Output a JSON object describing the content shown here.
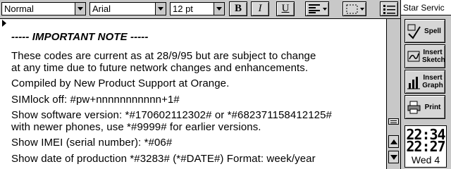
{
  "toolbar": {
    "style_select": "Normal",
    "font_select": "Arial",
    "size_select": "12 pt",
    "bold_label": "B",
    "italic_label": "I",
    "underline_label": "U"
  },
  "document": {
    "lines": [
      "----- IMPORTANT NOTE -----",
      "These codes are current as at 28/9/95 but are subject to change",
      "at any time due to future network changes and enhancements.",
      "Compiled by New Product Support at Orange.",
      "SIMlock off: #pw+nnnnnnnnnnn+1#",
      "Show software version: *#170602112302# or *#682371158412125#",
      "with newer phones, use *#9999# for earlier versions.",
      "Show IMEI (serial number): *#06#",
      "Show date of production *#3283# (*#DATE#) Format: week/year"
    ]
  },
  "sidebar": {
    "app_name": "Star Servic",
    "buttons": [
      {
        "label": "Spell",
        "icon": "spell-check-icon"
      },
      {
        "label": "Insert Sketch",
        "icon": "sketch-icon"
      },
      {
        "label": "Insert Graph",
        "icon": "graph-icon"
      },
      {
        "label": "Print",
        "icon": "printer-icon"
      }
    ],
    "clock": {
      "time_hours": "22:34",
      "time_minutes": "22:27",
      "day": "Wed 4"
    }
  },
  "colors": {
    "chrome": "#c8c8c8",
    "paper": "#ffffff",
    "ink": "#000000"
  }
}
